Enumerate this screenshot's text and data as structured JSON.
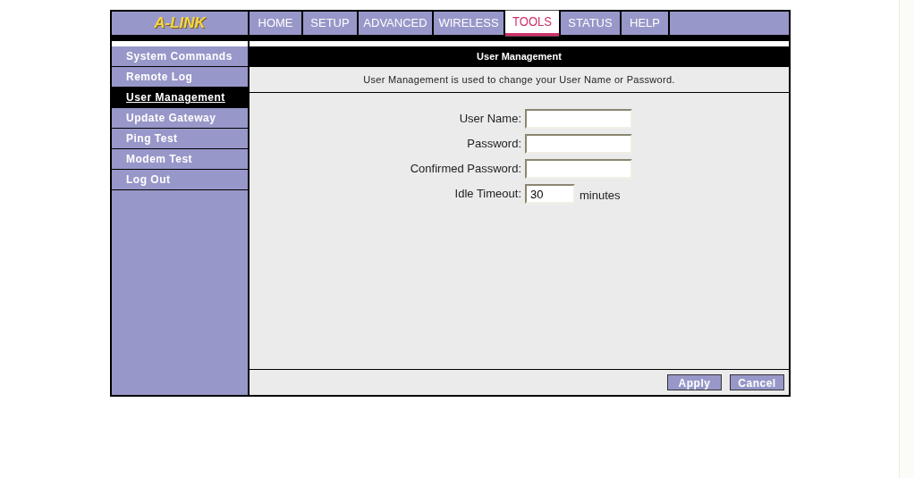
{
  "logo": "A-LINK",
  "tabs": [
    {
      "label": "HOME",
      "selected": false
    },
    {
      "label": "SETUP",
      "selected": false
    },
    {
      "label": "ADVANCED",
      "selected": false
    },
    {
      "label": "WIRELESS",
      "selected": false
    },
    {
      "label": "TOOLS",
      "selected": true
    },
    {
      "label": "STATUS",
      "selected": false
    },
    {
      "label": "HELP",
      "selected": false
    }
  ],
  "sidebar": {
    "items": [
      {
        "label": "System Commands",
        "selected": false
      },
      {
        "label": "Remote Log",
        "selected": false
      },
      {
        "label": "User Management",
        "selected": true
      },
      {
        "label": "Update Gateway",
        "selected": false
      },
      {
        "label": "Ping Test",
        "selected": false
      },
      {
        "label": "Modem Test",
        "selected": false
      },
      {
        "label": "Log Out",
        "selected": false
      }
    ]
  },
  "panel": {
    "title": "User Management",
    "description": "User Management is used to change your User Name or Password.",
    "fields": [
      {
        "label": "User Name:",
        "kind": "text"
      },
      {
        "label": "Password:",
        "kind": "password"
      },
      {
        "label": "Confirmed Password:",
        "kind": "password"
      },
      {
        "label": "Idle Timeout:",
        "kind": "short",
        "value": "30",
        "unit": "minutes"
      }
    ]
  },
  "buttons": [
    "Apply",
    "Cancel"
  ]
}
